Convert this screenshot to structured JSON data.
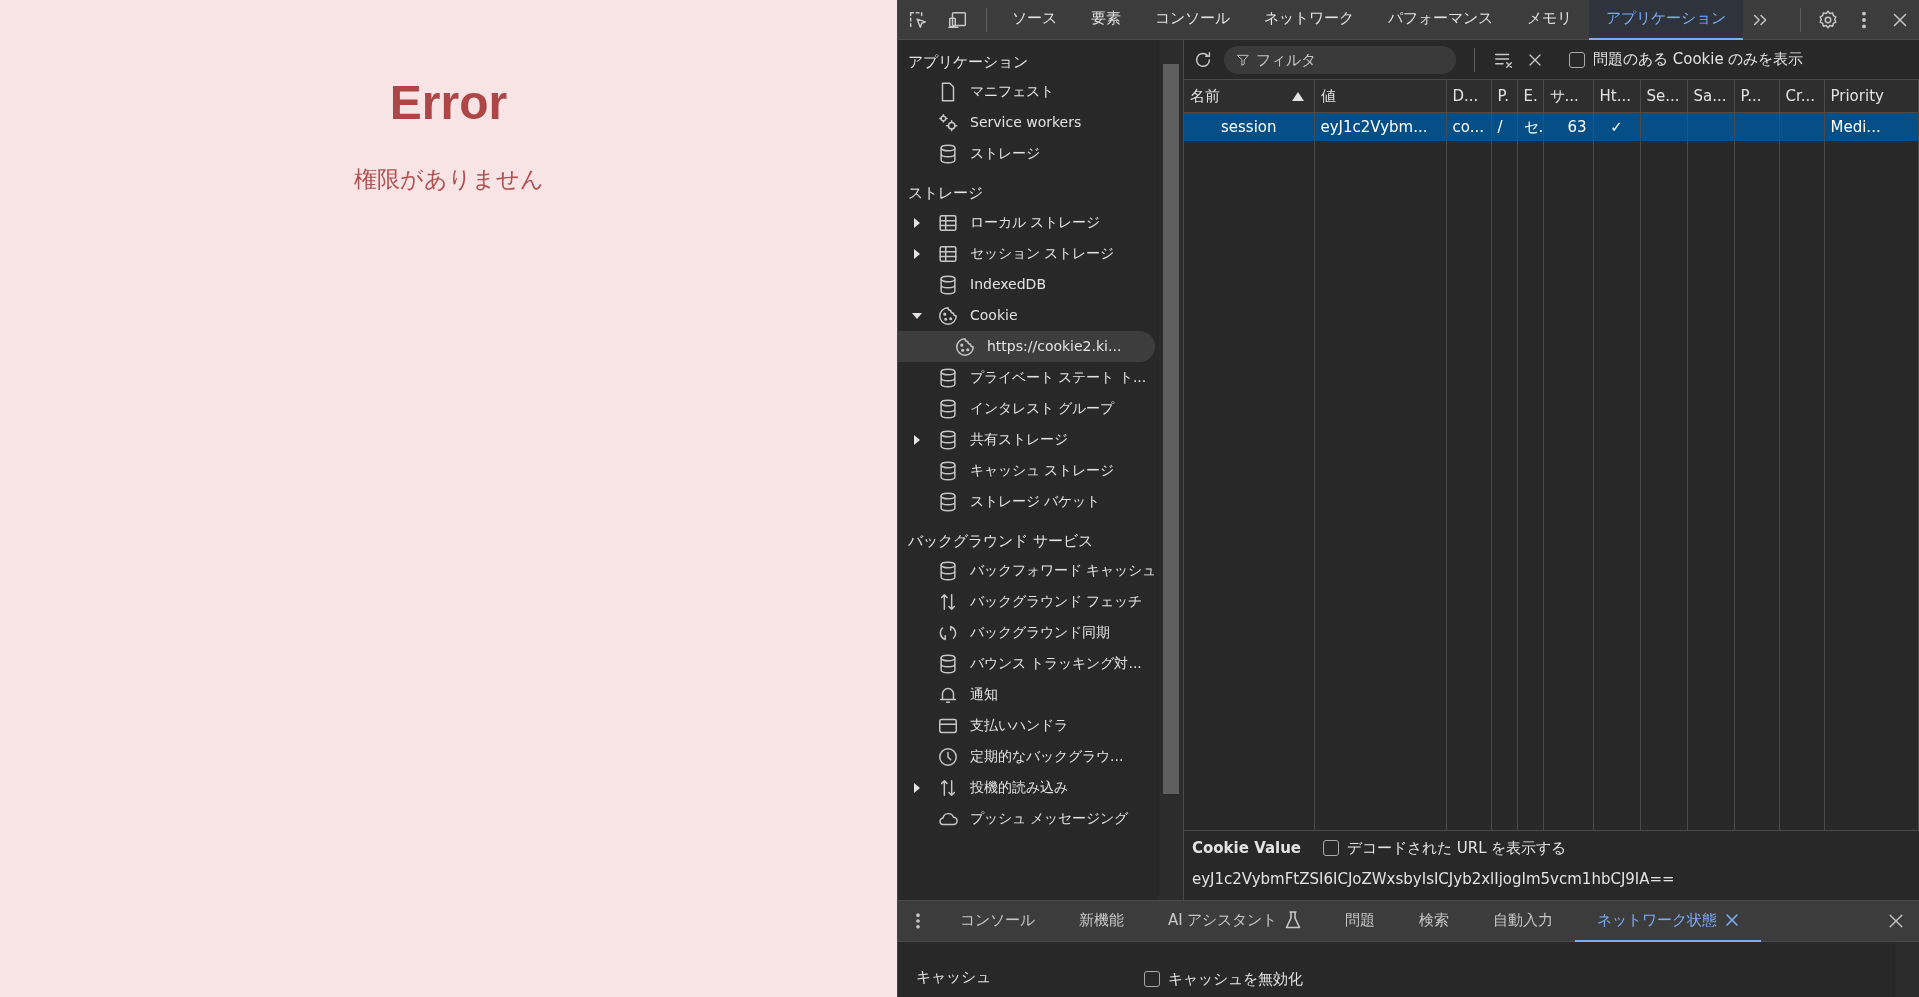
{
  "page": {
    "title": "Error",
    "message": "権限がありません"
  },
  "devtools": {
    "tabs": [
      {
        "label": "ソース",
        "selected": false
      },
      {
        "label": "要素",
        "selected": false
      },
      {
        "label": "コンソール",
        "selected": false
      },
      {
        "label": "ネットワーク",
        "selected": false
      },
      {
        "label": "パフォーマンス",
        "selected": false
      },
      {
        "label": "メモリ",
        "selected": false
      },
      {
        "label": "アプリケーション",
        "selected": true
      }
    ],
    "sidebar": [
      {
        "heading": "アプリケーション",
        "items": [
          {
            "label": "マニフェスト",
            "kind": "file",
            "selected": false
          },
          {
            "label": "Service workers",
            "kind": "gears",
            "selected": false
          },
          {
            "label": "ストレージ",
            "kind": "database",
            "selected": false
          }
        ]
      },
      {
        "heading": "ストレージ",
        "items": [
          {
            "label": "ローカル ストレージ",
            "kind": "table",
            "expanded": false,
            "selected": false
          },
          {
            "label": "セッション ストレージ",
            "kind": "table",
            "expanded": false,
            "selected": false
          },
          {
            "label": "IndexedDB",
            "kind": "database",
            "selected": false
          },
          {
            "label": "Cookie",
            "kind": "cookie",
            "expanded": true,
            "selected": false,
            "children": [
              {
                "label": "https://cookie2.ki...",
                "kind": "cookie",
                "selected": true
              }
            ]
          },
          {
            "label": "プライベート ステート ト...",
            "kind": "database",
            "selected": false
          },
          {
            "label": "インタレスト グループ",
            "kind": "database",
            "selected": false
          },
          {
            "label": "共有ストレージ",
            "kind": "database",
            "expanded": false,
            "selected": false
          },
          {
            "label": "キャッシュ ストレージ",
            "kind": "database",
            "selected": false
          },
          {
            "label": "ストレージ バケット",
            "kind": "database",
            "selected": false
          }
        ]
      },
      {
        "heading": "バックグラウンド サービス",
        "items": [
          {
            "label": "バックフォワード キャッシュ",
            "kind": "database",
            "selected": false
          },
          {
            "label": "バックグラウンド フェッチ",
            "kind": "arrows",
            "selected": false
          },
          {
            "label": "バックグラウンド同期",
            "kind": "sync",
            "selected": false
          },
          {
            "label": "バウンス トラッキング対...",
            "kind": "database",
            "selected": false
          },
          {
            "label": "通知",
            "kind": "bell",
            "selected": false
          },
          {
            "label": "支払いハンドラ",
            "kind": "card",
            "selected": false
          },
          {
            "label": "定期的なバックグラウ...",
            "kind": "clock",
            "selected": false
          },
          {
            "label": "投機的読み込み",
            "kind": "arrows",
            "expanded": false,
            "selected": false
          },
          {
            "label": "プッシュ メッセージング",
            "kind": "cloud",
            "selected": false
          }
        ]
      }
    ],
    "filter": {
      "placeholder": "フィルタ"
    },
    "issues_only": {
      "label": "問題のある Cookie のみを表示",
      "checked": false
    },
    "table": {
      "columns": [
        {
          "label": "名前",
          "sorted": true
        },
        {
          "label": "値"
        },
        {
          "label": "D..."
        },
        {
          "label": "P."
        },
        {
          "label": "E."
        },
        {
          "label": "サ..."
        },
        {
          "label": "Ht..."
        },
        {
          "label": "Se..."
        },
        {
          "label": "Sa..."
        },
        {
          "label": "P..."
        },
        {
          "label": "Cr..."
        },
        {
          "label": "Priority"
        }
      ],
      "rows": [
        {
          "selected": true,
          "cells": [
            "session",
            "eyJ1c2Vybm...",
            "co...",
            "/",
            "セ.",
            "63",
            "✓",
            "",
            "",
            "",
            "",
            "Medi..."
          ]
        }
      ]
    },
    "cookie_value": {
      "title": "Cookie Value",
      "decode": {
        "label": "デコードされた URL を表示する",
        "checked": false
      },
      "value": "eyJ1c2VybmFtZSI6ICJoZWxsbyIsICJyb2xlIjogIm5vcm1hbCJ9IA=="
    },
    "drawer": {
      "tabs": [
        {
          "label": "コンソール",
          "kind": "plain",
          "selected": false
        },
        {
          "label": "新機能",
          "kind": "plain",
          "selected": false
        },
        {
          "label": "AI アシスタント",
          "kind": "lab",
          "selected": false
        },
        {
          "label": "問題",
          "kind": "plain",
          "selected": false
        },
        {
          "label": "検索",
          "kind": "plain",
          "selected": false
        },
        {
          "label": "自動入力",
          "kind": "plain",
          "selected": false
        },
        {
          "label": "ネットワーク状態",
          "kind": "closable",
          "selected": true
        }
      ],
      "section": "キャッシュ",
      "disable_cache": {
        "label": "キャッシュを無効化",
        "checked": false
      }
    }
  }
}
